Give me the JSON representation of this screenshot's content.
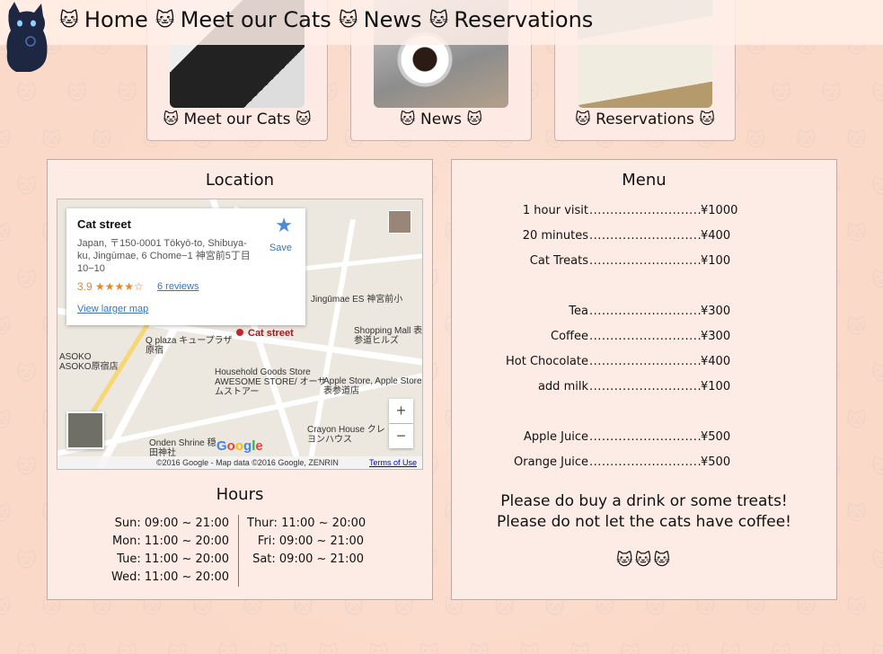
{
  "nav": {
    "items": [
      {
        "label": "Home"
      },
      {
        "label": "Meet our Cats"
      },
      {
        "label": "News"
      },
      {
        "label": "Reservations"
      }
    ],
    "glyph": "🐱"
  },
  "cards": [
    {
      "caption": "🐱 Meet our Cats 🐱"
    },
    {
      "caption": "🐱 News 🐱"
    },
    {
      "caption": "🐱 Reservations 🐱"
    }
  ],
  "location": {
    "title": "Location",
    "map": {
      "place_name": "Cat street",
      "address": "Japan, 〒150-0001 Tōkyō-to, Shibuya-ku, Jingūmae, 6 Chome−1 神宮前5丁目10−10",
      "rating": "3.9 ★★★★☆",
      "reviews": "6 reviews",
      "larger_map": "View larger map",
      "save": "Save",
      "pin_label": "Cat street",
      "labels": [
        "Jingūmae ES 神宮前小",
        "Shopping Mall 表参道ヒルズ",
        "Q plaza キュープラザ原宿",
        "ASOKO ASOKO原宿店",
        "Household Goods Store AWESOME STORE/ オーサムストアー",
        "Apple Store, Apple Store 表参道店",
        "Crayon House クレヨンハウス",
        "Onden Shrine 穏田神社"
      ],
      "google": "Google",
      "copyright": "©2016 Google - Map data ©2016 Google, ZENRIN",
      "terms": "Terms of Use",
      "zoom_in": "+",
      "zoom_out": "−"
    }
  },
  "hours": {
    "title": "Hours",
    "left": [
      {
        "day": "Sun:",
        "time": "09:00 ~ 21:00"
      },
      {
        "day": "Mon:",
        "time": "11:00 ~ 20:00"
      },
      {
        "day": "Tue:",
        "time": "11:00 ~ 20:00"
      },
      {
        "day": "Wed:",
        "time": "11:00 ~ 20:00"
      }
    ],
    "right": [
      {
        "day": "Thur:",
        "time": "11:00 ~ 20:00"
      },
      {
        "day": "Fri:",
        "time": "09:00 ~ 21:00"
      },
      {
        "day": "Sat:",
        "time": "09:00 ~ 21:00"
      }
    ]
  },
  "menu": {
    "title": "Menu",
    "items": [
      {
        "name": "1 hour visit",
        "price": "¥1000"
      },
      {
        "name": "20 minutes",
        "price": "¥400"
      },
      {
        "name": "Cat Treats",
        "price": "¥100"
      },
      {
        "name": "Tea",
        "price": "¥300"
      },
      {
        "name": "Coffee",
        "price": "¥300"
      },
      {
        "name": "Hot Chocolate",
        "price": "¥400"
      },
      {
        "name": "add milk",
        "price": "¥100"
      },
      {
        "name": "Apple Juice",
        "price": "¥500"
      },
      {
        "name": "Orange Juice",
        "price": "¥500"
      }
    ],
    "notice_1": "Please do buy a drink or some treats!",
    "notice_2": "Please do not let the cats have coffee!",
    "cats": "🐱🐱🐱"
  }
}
